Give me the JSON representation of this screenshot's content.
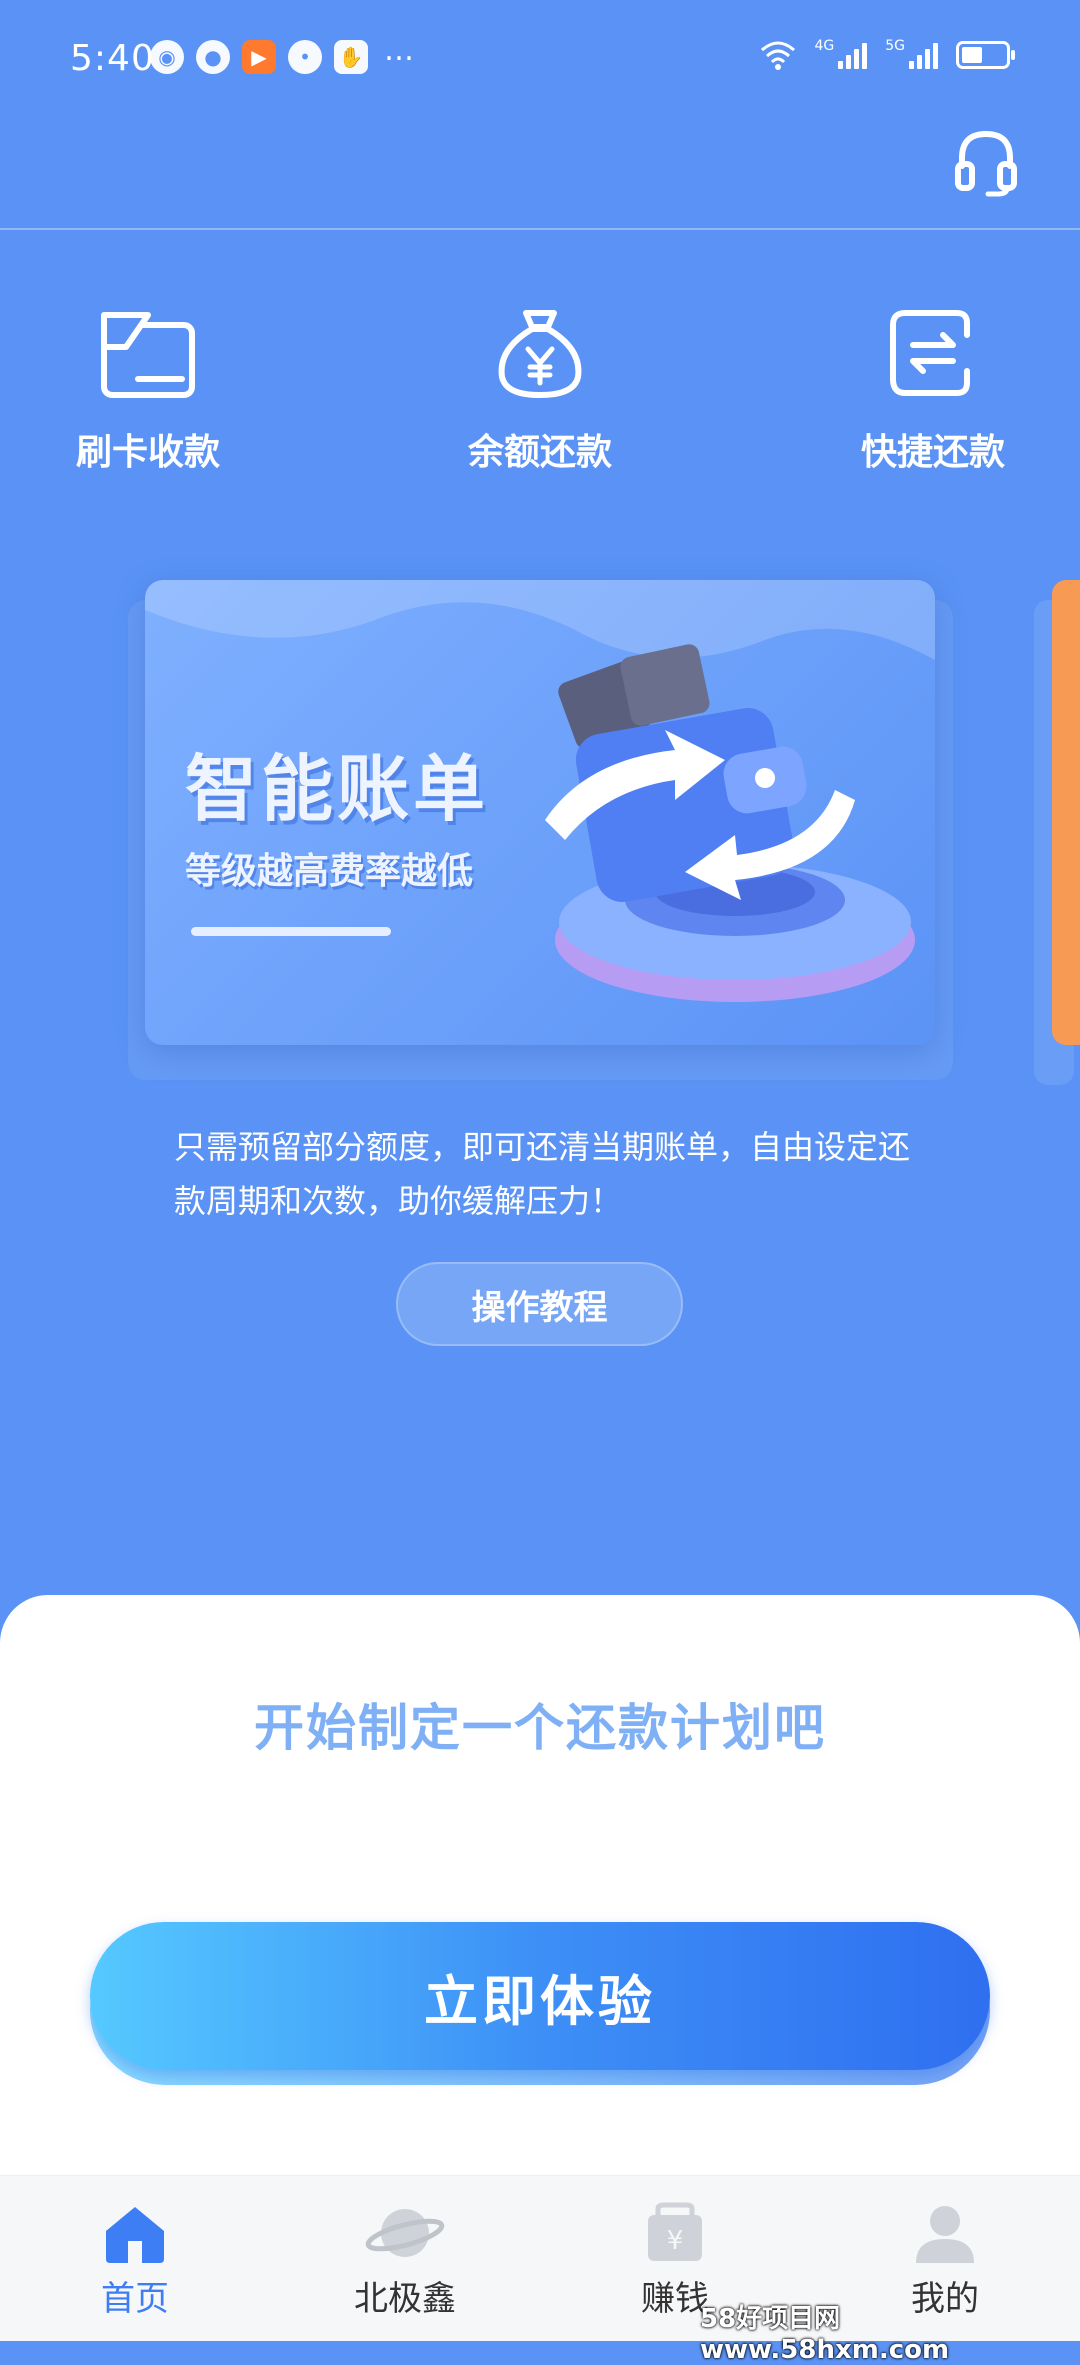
{
  "status": {
    "time": "5:40",
    "net1": "4G",
    "net2": "5G"
  },
  "quick_actions": [
    {
      "label": "刷卡收款",
      "icon": "card-swipe-icon"
    },
    {
      "label": "余额还款",
      "icon": "money-bag-icon"
    },
    {
      "label": "快捷还款",
      "icon": "transfer-arrows-icon"
    }
  ],
  "banner": {
    "title": "智能账单",
    "subtitle": "等级越高费率越低"
  },
  "description": "只需预留部分额度，即可还清当期账单，自由设定还款周期和次数，助你缓解压力！",
  "tutorial_button": "操作教程",
  "plan_title": "开始制定一个还款计划吧",
  "try_button": "立即体验",
  "tabs": [
    {
      "label": "首页",
      "icon": "home-icon"
    },
    {
      "label": "北极鑫",
      "icon": "planet-icon"
    },
    {
      "label": "赚钱",
      "icon": "earn-bag-icon"
    },
    {
      "label": "我的",
      "icon": "user-icon"
    }
  ],
  "watermark": "58好项目网www.58hxm.com",
  "colors": {
    "primary_bg": "#5a93f5",
    "accent": "#3d7ef5"
  }
}
